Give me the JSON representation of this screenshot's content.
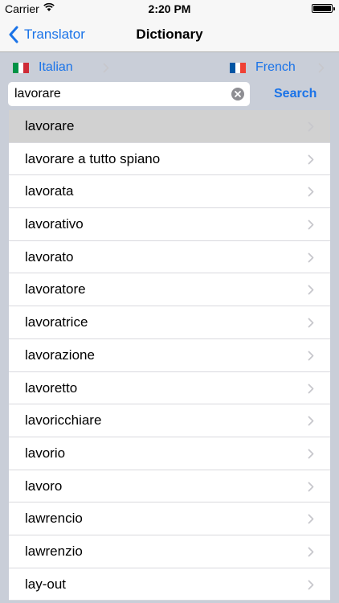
{
  "status_bar": {
    "carrier": "Carrier",
    "time": "2:20 PM"
  },
  "nav": {
    "back_label": "Translator",
    "title": "Dictionary"
  },
  "languages": {
    "source": {
      "name": "Italian",
      "flag_colors": [
        "#009246",
        "#ffffff",
        "#ce2b37"
      ]
    },
    "target": {
      "name": "French",
      "flag_colors": [
        "#0055a4",
        "#ffffff",
        "#ef4135"
      ]
    }
  },
  "search": {
    "value": "lavorare",
    "button_label": "Search"
  },
  "results": [
    {
      "label": "lavorare",
      "selected": true
    },
    {
      "label": "lavorare a tutto spiano"
    },
    {
      "label": "lavorata"
    },
    {
      "label": "lavorativo"
    },
    {
      "label": "lavorato"
    },
    {
      "label": "lavoratore"
    },
    {
      "label": "lavoratrice"
    },
    {
      "label": "lavorazione"
    },
    {
      "label": "lavoretto"
    },
    {
      "label": "lavoricchiare"
    },
    {
      "label": "lavorio"
    },
    {
      "label": "lavoro"
    },
    {
      "label": "lawrencio"
    },
    {
      "label": "lawrenzio"
    },
    {
      "label": "lay-out"
    }
  ],
  "colors": {
    "accent": "#1a73e8",
    "background": "#c9ced8",
    "selected_row": "#d1d1d1"
  }
}
